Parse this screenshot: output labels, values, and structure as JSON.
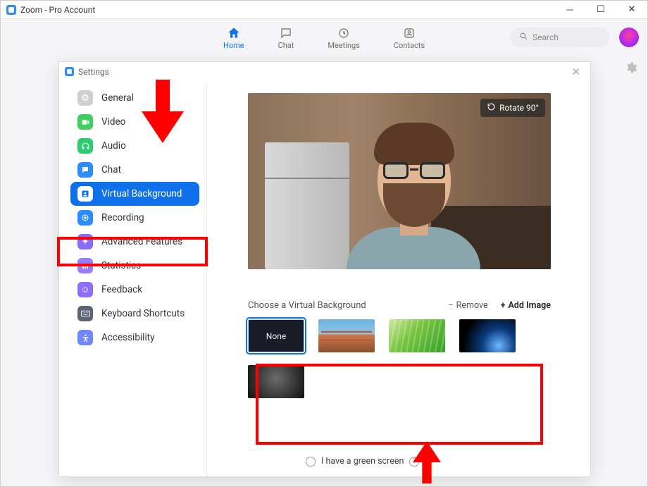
{
  "window": {
    "title": "Zoom - Pro Account"
  },
  "nav": {
    "tabs": [
      {
        "label": "Home",
        "icon": "home-icon",
        "active": true
      },
      {
        "label": "Chat",
        "icon": "chat-bubble-icon",
        "active": false
      },
      {
        "label": "Meetings",
        "icon": "clock-icon",
        "active": false
      },
      {
        "label": "Contacts",
        "icon": "person-box-icon",
        "active": false
      }
    ],
    "search_placeholder": "Search"
  },
  "settings": {
    "title": "Settings",
    "sidebar": [
      {
        "label": "General",
        "icon": "gear-icon",
        "color": "gray",
        "active": false
      },
      {
        "label": "Video",
        "icon": "video-camera-icon",
        "color": "green",
        "active": false
      },
      {
        "label": "Audio",
        "icon": "headphones-icon",
        "color": "green2",
        "active": false
      },
      {
        "label": "Chat",
        "icon": "chat-bubble-icon",
        "color": "blue",
        "active": false
      },
      {
        "label": "Virtual Background",
        "icon": "portrait-box-icon",
        "color": "blue",
        "active": true
      },
      {
        "label": "Recording",
        "icon": "record-disc-icon",
        "color": "blue",
        "active": false
      },
      {
        "label": "Advanced Features",
        "icon": "sparkle-icon",
        "color": "purple",
        "active": false
      },
      {
        "label": "Statistics",
        "icon": "bar-chart-icon",
        "color": "pbar",
        "active": false
      },
      {
        "label": "Feedback",
        "icon": "smiley-icon",
        "color": "smile",
        "active": false
      },
      {
        "label": "Keyboard Shortcuts",
        "icon": "keyboard-icon",
        "color": "kbd",
        "active": false
      },
      {
        "label": "Accessibility",
        "icon": "accessibility-icon",
        "color": "person",
        "active": false
      }
    ],
    "virtual_background": {
      "rotate_label": "Rotate 90°",
      "choose_label": "Choose a Virtual Background",
      "remove_label": "Remove",
      "add_image_label": "Add Image",
      "none_label": "None",
      "backgrounds": [
        {
          "name": "None",
          "selected": true,
          "kind": "none"
        },
        {
          "name": "Golden Gate Bridge",
          "selected": false,
          "kind": "bridge"
        },
        {
          "name": "Grass",
          "selected": false,
          "kind": "grass"
        },
        {
          "name": "Space",
          "selected": false,
          "kind": "space"
        },
        {
          "name": "Blur",
          "selected": false,
          "kind": "blur"
        }
      ],
      "green_screen_label": "I have a green screen",
      "green_screen_checked": false
    }
  }
}
